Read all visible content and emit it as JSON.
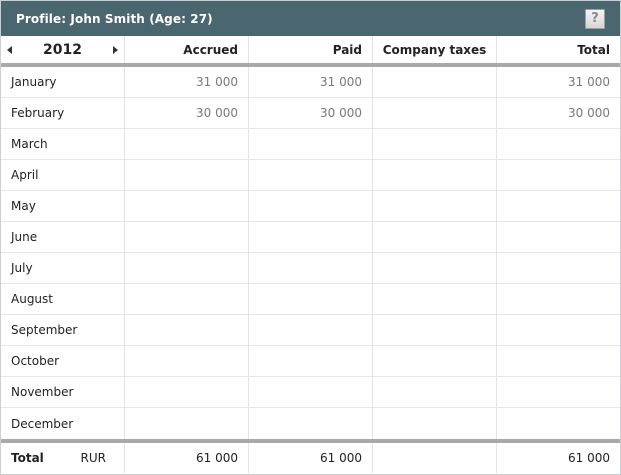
{
  "window": {
    "title": "Profile: John Smith (Age: 27)",
    "help_label": "?"
  },
  "header": {
    "year": "2012",
    "columns": [
      "Accrued",
      "Paid",
      "Company taxes",
      "Total"
    ]
  },
  "rows": [
    {
      "month": "January",
      "accrued": "31 000",
      "paid": "31 000",
      "company_taxes": "",
      "total": "31 000"
    },
    {
      "month": "February",
      "accrued": "30 000",
      "paid": "30 000",
      "company_taxes": "",
      "total": "30 000"
    },
    {
      "month": "March",
      "accrued": "",
      "paid": "",
      "company_taxes": "",
      "total": ""
    },
    {
      "month": "April",
      "accrued": "",
      "paid": "",
      "company_taxes": "",
      "total": ""
    },
    {
      "month": "May",
      "accrued": "",
      "paid": "",
      "company_taxes": "",
      "total": ""
    },
    {
      "month": "June",
      "accrued": "",
      "paid": "",
      "company_taxes": "",
      "total": ""
    },
    {
      "month": "July",
      "accrued": "",
      "paid": "",
      "company_taxes": "",
      "total": ""
    },
    {
      "month": "August",
      "accrued": "",
      "paid": "",
      "company_taxes": "",
      "total": ""
    },
    {
      "month": "September",
      "accrued": "",
      "paid": "",
      "company_taxes": "",
      "total": ""
    },
    {
      "month": "October",
      "accrued": "",
      "paid": "",
      "company_taxes": "",
      "total": ""
    },
    {
      "month": "November",
      "accrued": "",
      "paid": "",
      "company_taxes": "",
      "total": ""
    },
    {
      "month": "December",
      "accrued": "",
      "paid": "",
      "company_taxes": "",
      "total": ""
    }
  ],
  "totals": {
    "label": "Total",
    "currency": "RUR",
    "accrued": "61 000",
    "paid": "61 000",
    "company_taxes": "",
    "total": "61 000"
  },
  "colors": {
    "titlebar": "#4a6770",
    "separator": "#a9a9a9"
  }
}
